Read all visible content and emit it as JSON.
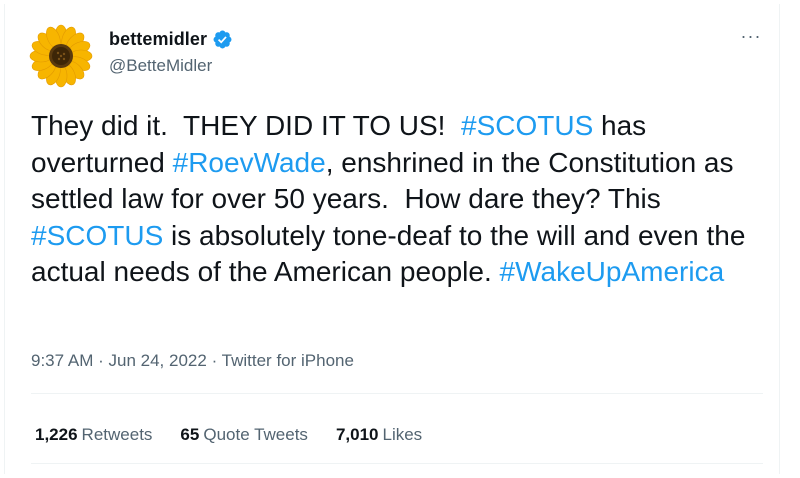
{
  "author": {
    "display_name": "bettemidler",
    "handle": "@BetteMidler",
    "verified": true,
    "avatar_icon": "sunflower-icon"
  },
  "tweet": {
    "segments": [
      {
        "text": "They did it.  THEY DID IT TO US!  ",
        "type": "text"
      },
      {
        "text": "#SCOTUS",
        "type": "hashtag"
      },
      {
        "text": " has overturned ",
        "type": "text"
      },
      {
        "text": "#RoevWade",
        "type": "hashtag"
      },
      {
        "text": ", enshrined in the Constitution as settled law for over 50 years.  How dare they? This ",
        "type": "text"
      },
      {
        "text": "#SCOTUS",
        "type": "hashtag"
      },
      {
        "text": " is absolutely tone-deaf to the will and even the actual needs of the American people. ",
        "type": "text"
      },
      {
        "text": "#WakeUpAmerica",
        "type": "hashtag"
      }
    ]
  },
  "meta": {
    "time": "9:37 AM",
    "date": "Jun 24, 2022",
    "source": "Twitter for iPhone",
    "separator": "·"
  },
  "stats": {
    "retweets_count": "1,226",
    "retweets_label": "Retweets",
    "quotes_count": "65",
    "quotes_label": "Quote Tweets",
    "likes_count": "7,010",
    "likes_label": "Likes"
  },
  "colors": {
    "hashtag": "#1d9bf0",
    "secondary_text": "#536471",
    "verified": "#1d9bf0"
  },
  "more_icon": "more-options-icon",
  "more_glyph": "···"
}
